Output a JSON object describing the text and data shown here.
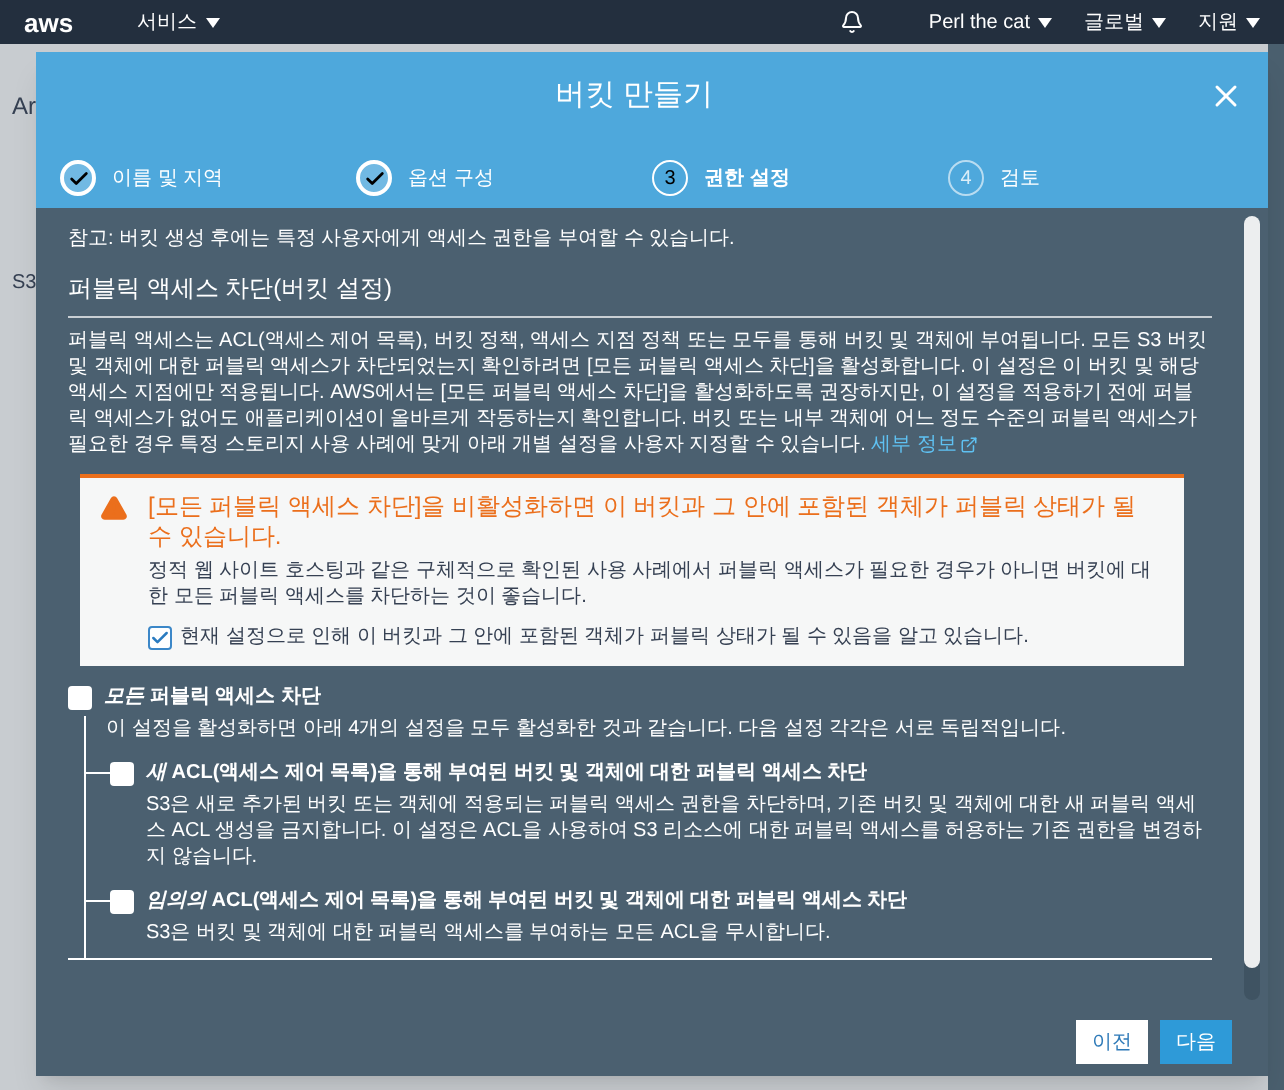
{
  "top_nav": {
    "logo": "aws",
    "services": "서비스",
    "user": "Perl the cat",
    "region": "글로벌",
    "support": "지원"
  },
  "background_page": {
    "title": "Ar",
    "item": "S3"
  },
  "dialog": {
    "title": "버킷 만들기",
    "steps": [
      {
        "label": "이름 및 지역",
        "completed": true,
        "selected": false
      },
      {
        "label": "옵션 구성",
        "completed": true,
        "selected": false
      },
      {
        "number": "3",
        "label": "권한 설정",
        "completed": false,
        "selected": true
      },
      {
        "number": "4",
        "label": "검토",
        "completed": false,
        "selected": false
      }
    ],
    "note": "참고: 버킷 생성 후에는 특정 사용자에게 액세스 권한을 부여할 수 있습니다.",
    "section_title": "퍼블릭 액세스 차단(버킷 설정)",
    "description": "퍼블릭 액세스는 ACL(액세스 제어 목록), 버킷 정책, 액세스 지점 정책 또는 모두를 통해 버킷 및 객체에 부여됩니다. 모든 S3 버킷 및 객체에 대한 퍼블릭 액세스가 차단되었는지 확인하려면 [모든 퍼블릭 액세스 차단]을 활성화합니다. 이 설정은 이 버킷 및 해당 액세스 지점에만 적용됩니다. AWS에서는 [모든 퍼블릭 액세스 차단]을 활성화하도록 권장하지만, 이 설정을 적용하기 전에 퍼블릭 액세스가 없어도 애플리케이션이 올바르게 작동하는지 확인합니다. 버킷 또는 내부 객체에 어느 정도 수준의 퍼블릭 액세스가 필요한 경우 특정 스토리지 사용 사례에 맞게 아래 개별 설정을 사용자 지정할 수 있습니다.",
    "learn_more": "세부 정보",
    "warning": {
      "title": "[모든 퍼블릭 액세스 차단]을 비활성화하면 이 버킷과 그 안에 포함된 객체가 퍼블릭 상태가 될 수 있습니다.",
      "body": "정적 웹 사이트 호스팅과 같은 구체적으로 확인된 사용 사례에서 퍼블릭 액세스가 필요한 경우가 아니면 버킷에 대한 모든 퍼블릭 액세스를 차단하는 것이 좋습니다.",
      "acknowledge": {
        "label": "현재 설정으로 인해 이 버킷과 그 안에 포함된 객체가 퍼블릭 상태가 될 수 있음을 알고 있습니다.",
        "checked": true
      }
    },
    "options": [
      {
        "label": "*모든* 퍼블릭 액세스 차단",
        "description": "이 설정을 활성화하면 아래 4개의 설정을 모두 활성화한 것과 같습니다. 다음 설정 각각은 서로 독립적입니다.",
        "checked": false,
        "children": [
          {
            "label": "*새* ACL(액세스 제어 목록)을 통해 부여된 버킷 및 객체에 대한 퍼블릭 액세스 차단",
            "description": "S3은 새로 추가된 버킷 또는 객체에 적용되는 퍼블릭 액세스 권한을 차단하며, 기존 버킷 및 객체에 대한 새 퍼블릭 액세스 ACL 생성을 금지합니다. 이 설정은 ACL을 사용하여 S3 리소스에 대한 퍼블릭 액세스를 허용하는 기존 권한을 변경하지 않습니다.",
            "checked": false
          },
          {
            "label": "*임의의* ACL(액세스 제어 목록)을 통해 부여된 버킷 및 객체에 대한 퍼블릭 액세스 차단",
            "description": "S3은 버킷 및 객체에 대한 퍼블릭 액세스를 부여하는 모든 ACL을 무시합니다.",
            "checked": false
          }
        ]
      }
    ],
    "buttons": [
      {
        "label": "이전",
        "kind": "secondary"
      },
      {
        "label": "다음",
        "kind": "primary"
      }
    ]
  }
}
